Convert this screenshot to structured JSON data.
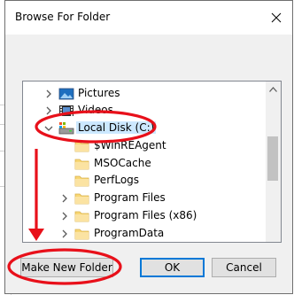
{
  "dialog": {
    "title": "Browse For Folder",
    "close_glyph": "✕",
    "tree": {
      "items": [
        {
          "label": "Pictures",
          "icon": "pictures-folder-icon",
          "chevron": "collapsed"
        },
        {
          "label": "Videos",
          "icon": "videos-folder-icon",
          "chevron": "collapsed"
        },
        {
          "label": "Local Disk (C:)",
          "icon": "local-disk-icon",
          "chevron": "expanded",
          "selected": true
        },
        {
          "label": "$WinREAgent",
          "icon": "folder-icon",
          "chevron": "none"
        },
        {
          "label": "MSOCache",
          "icon": "folder-icon",
          "chevron": "none"
        },
        {
          "label": "PerfLogs",
          "icon": "folder-icon",
          "chevron": "none"
        },
        {
          "label": "Program Files",
          "icon": "folder-icon",
          "chevron": "collapsed"
        },
        {
          "label": "Program Files (x86)",
          "icon": "folder-icon",
          "chevron": "collapsed"
        },
        {
          "label": "ProgramData",
          "icon": "folder-icon",
          "chevron": "collapsed"
        }
      ]
    },
    "buttons": {
      "make_new_folder": "Make New Folder",
      "ok": "OK",
      "cancel": "Cancel"
    }
  },
  "colors": {
    "annotation": "#e8101a",
    "selection": "#cce8ff",
    "folder": "#f8d775"
  }
}
